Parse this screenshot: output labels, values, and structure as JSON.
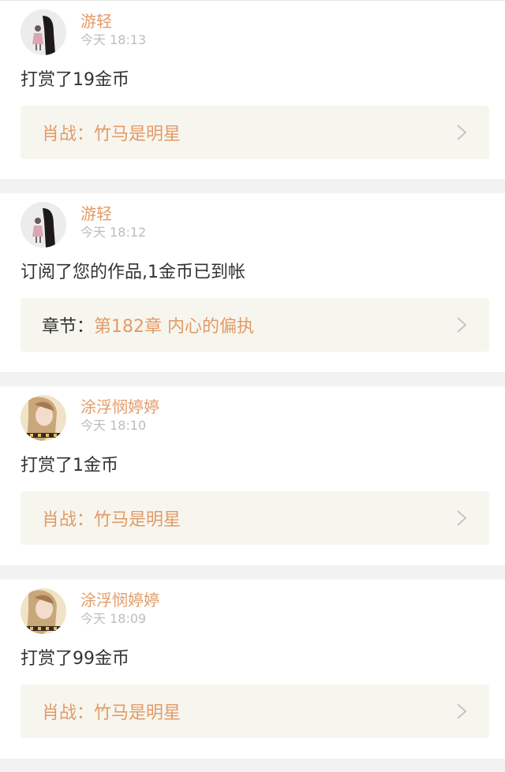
{
  "feed": [
    {
      "user": "游轻",
      "time": "今天 18:13",
      "avatar": "girl-silhouette-avatar",
      "message": "打赏了19金币",
      "link_prefix": "肖战：",
      "link_prefix_color": "#e39a66",
      "link_title": "竹马是明星"
    },
    {
      "user": "游轻",
      "time": "今天 18:12",
      "avatar": "girl-silhouette-avatar",
      "message": "订阅了您的作品,1金币已到帐",
      "link_prefix": "章节：",
      "link_prefix_color": "#333333",
      "link_title": "第182章 内心的偏执"
    },
    {
      "user": "涂浮悯婷婷",
      "time": "今天 18:10",
      "avatar": "portrait-photo-avatar",
      "message": "打赏了1金币",
      "link_prefix": "肖战：",
      "link_prefix_color": "#e39a66",
      "link_title": "竹马是明星"
    },
    {
      "user": "涂浮悯婷婷",
      "time": "今天 18:09",
      "avatar": "portrait-photo-avatar",
      "message": "打赏了99金币",
      "link_prefix": "肖战：",
      "link_prefix_color": "#e39a66",
      "link_title": "竹马是明星"
    }
  ],
  "colors": {
    "accent": "#e39a66",
    "link_background": "#f6f6ef",
    "page_background": "#f2f2f2"
  }
}
